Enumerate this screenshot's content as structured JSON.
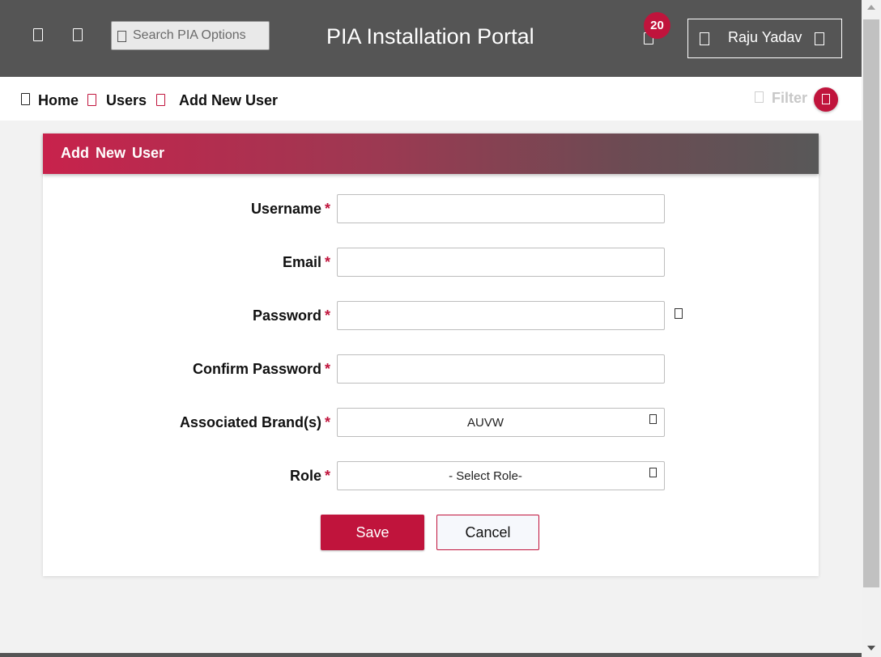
{
  "topbar": {
    "menu_icon": "menu-icon",
    "home_icon": "home-icon",
    "search_placeholder": "Search PIA Options",
    "portal_title": "PIA Installation Portal",
    "notification_count": "20",
    "user_name": "Raju Yadav"
  },
  "breadcrumb": {
    "home": "Home",
    "users": "Users",
    "current": "Add New User",
    "filter_label": "Filter"
  },
  "form": {
    "title": "Add New User",
    "fields": {
      "username": {
        "label": "Username",
        "value": ""
      },
      "email": {
        "label": "Email",
        "value": ""
      },
      "password": {
        "label": "Password",
        "value": ""
      },
      "confirm_password": {
        "label": "Confirm Password",
        "value": ""
      },
      "brands": {
        "label": "Associated Brand(s)",
        "value": "AUVW"
      },
      "role": {
        "label": "Role",
        "value": "- Select Role-"
      }
    },
    "required_marker": "*",
    "save_label": "Save",
    "cancel_label": "Cancel"
  },
  "colors": {
    "topbar": "#555555",
    "accent": "#c0143c",
    "header_gradient_start": "#c8224c",
    "header_gradient_end": "#585858"
  }
}
